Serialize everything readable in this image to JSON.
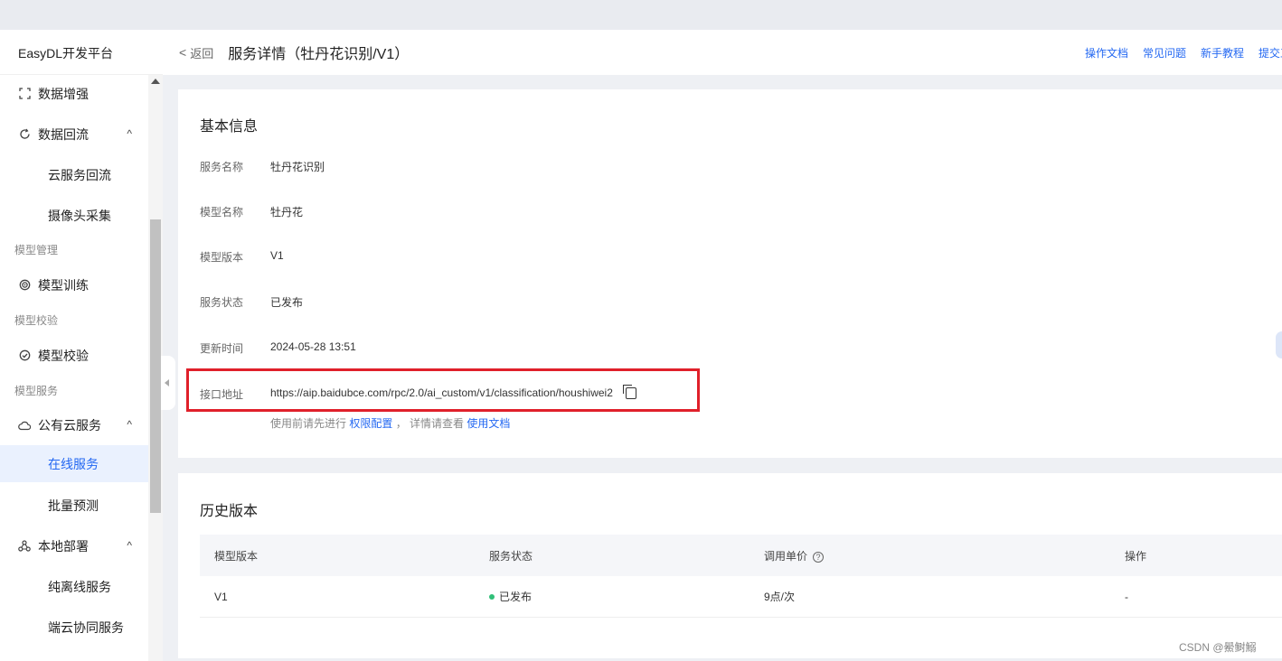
{
  "sidebar": {
    "brand": "EasyDL开发平台",
    "items": [
      {
        "label": "数据增强",
        "icon": "data-enhance-icon"
      },
      {
        "label": "数据回流",
        "icon": "data-reflow-icon"
      },
      {
        "label": "云服务回流"
      },
      {
        "label": "摄像头采集"
      },
      {
        "label": "模型训练",
        "icon": "model-train-icon"
      },
      {
        "label": "模型校验",
        "icon": "model-check-icon"
      },
      {
        "label": "公有云服务",
        "icon": "cloud-icon"
      },
      {
        "label": "在线服务"
      },
      {
        "label": "批量预测"
      },
      {
        "label": "本地部署",
        "icon": "local-deploy-icon"
      },
      {
        "label": "纯离线服务"
      },
      {
        "label": "端云协同服务"
      }
    ],
    "groups": [
      "模型管理",
      "模型校验",
      "模型服务"
    ],
    "chevron": "^"
  },
  "header": {
    "back_arrow": "<",
    "back_label": "返回",
    "title": "服务详情（牡丹花识别/V1）",
    "links": [
      "操作文档",
      "常见问题",
      "新手教程",
      "提交工单"
    ]
  },
  "basic": {
    "title": "基本信息",
    "rows": [
      {
        "label": "服务名称",
        "value": "牡丹花识别"
      },
      {
        "label": "模型名称",
        "value": "牡丹花"
      },
      {
        "label": "模型版本",
        "value": "V1"
      },
      {
        "label": "服务状态",
        "value": "已发布"
      },
      {
        "label": "更新时间",
        "value": "2024-05-28 13:51"
      },
      {
        "label": "接口地址",
        "value": "https://aip.baidubce.com/rpc/2.0/ai_custom/v1/classification/houshiwei2"
      }
    ],
    "hint_prefix": "使用前请先进行",
    "hint_link1": "权限配置",
    "hint_middle": "，  详情请查看",
    "hint_link2": "使用文档"
  },
  "history": {
    "title": "历史版本",
    "columns": [
      "模型版本",
      "服务状态",
      "调用单价",
      "操作"
    ],
    "help_glyph": "?",
    "rows": [
      {
        "version": "V1",
        "status": "已发布",
        "price": "9点/次",
        "action": "-"
      }
    ]
  },
  "watermark": "CSDN @鱟鲥鰯",
  "colors": {
    "accent": "#2468f2",
    "highlight": "#e0202a",
    "status_ok": "#30bf78"
  }
}
